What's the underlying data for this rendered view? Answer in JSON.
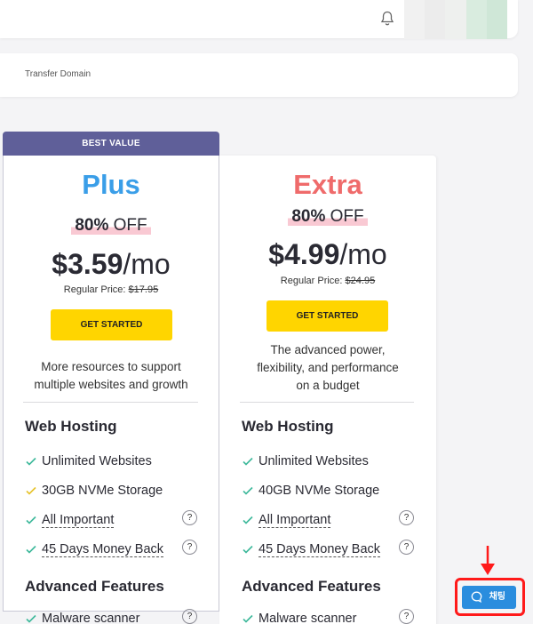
{
  "header": {
    "notification_icon": "bell-icon"
  },
  "domain_bar": {
    "label": "Transfer Domain"
  },
  "plans": [
    {
      "badge": "BEST VALUE",
      "name": "Plus",
      "name_color": "#3a9ee8",
      "off_pct": "80%",
      "off_word": "OFF",
      "price": "$3.59",
      "per": "/mo",
      "regular_label": "Regular Price:",
      "regular_price": "$17.95",
      "cta": "GET STARTED",
      "description": [
        "More resources to support",
        "multiple websites and growth"
      ],
      "section": "Web Hosting",
      "features": [
        {
          "text": "Unlimited Websites",
          "check_color": "#3cb89a",
          "help": false
        },
        {
          "text": "30GB NVMe Storage",
          "check_color": "#e6c229",
          "help": false
        },
        {
          "text": "All Important",
          "check_color": "#3cb89a",
          "help": true
        },
        {
          "text": "45 Days Money Back",
          "check_color": "#3cb89a",
          "help": true
        }
      ],
      "section2": "Advanced Features",
      "feature_cut": "Malware scanner"
    },
    {
      "name": "Extra",
      "name_color": "#ef6b6b",
      "off_pct": "80%",
      "off_word": "OFF",
      "price": "$4.99",
      "per": "/mo",
      "regular_label": "Regular Price:",
      "regular_price": "$24.95",
      "cta": "GET STARTED",
      "description": [
        "The advanced power,",
        "flexibility, and performance",
        "on a budget"
      ],
      "section": "Web Hosting",
      "features": [
        {
          "text": "Unlimited Websites",
          "check_color": "#3cb89a",
          "help": false
        },
        {
          "text": "40GB NVMe Storage",
          "check_color": "#3cb89a",
          "help": false
        },
        {
          "text": "All Important",
          "check_color": "#3cb89a",
          "help": true
        },
        {
          "text": "45 Days Money Back",
          "check_color": "#3cb89a",
          "help": true
        }
      ],
      "section2": "Advanced Features",
      "feature_cut": "Malware scanner"
    }
  ],
  "help_glyph": "?",
  "chat": {
    "label": "채팅",
    "color": "#2a8dde",
    "highlight_color": "#ff1a1a"
  }
}
